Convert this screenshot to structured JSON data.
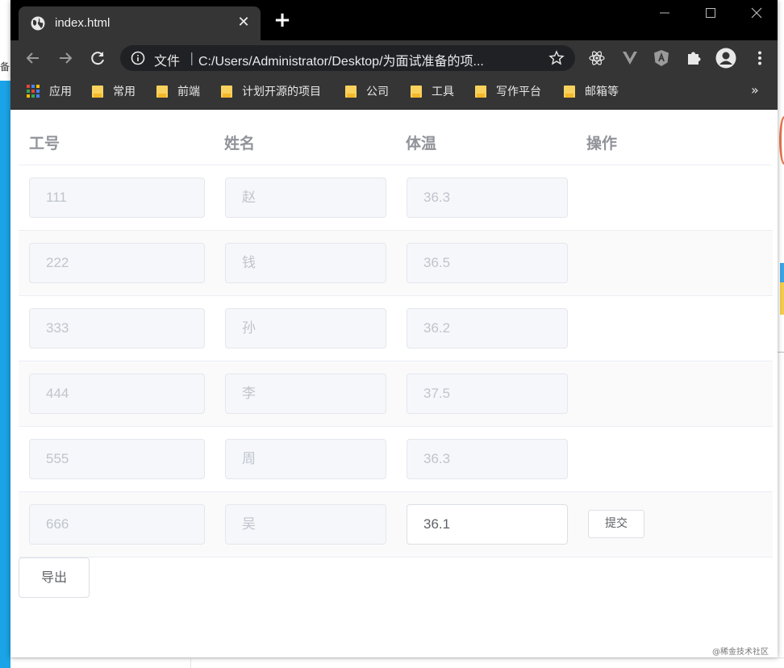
{
  "desktop": {
    "left_glyph": "备"
  },
  "browser": {
    "tab_title": "index.html",
    "omnibox": {
      "label": "文件",
      "separator": "|",
      "url": "C:/Users/Administrator/Desktop/为面试准备的项..."
    },
    "bookmarks": [
      {
        "label": "应用",
        "icon": "apps-grid-icon"
      },
      {
        "label": "常用",
        "icon": "folder-icon"
      },
      {
        "label": "前端",
        "icon": "folder-icon"
      },
      {
        "label": "计划开源的项目",
        "icon": "folder-icon"
      },
      {
        "label": "公司",
        "icon": "folder-icon"
      },
      {
        "label": "工具",
        "icon": "folder-icon"
      },
      {
        "label": "写作平台",
        "icon": "folder-icon"
      },
      {
        "label": "邮箱等",
        "icon": "folder-icon"
      }
    ],
    "bookmarks_overflow": "»",
    "colors": {
      "chrome_dark": "#353535",
      "titlebar": "#000000",
      "omnibox": "#202124"
    }
  },
  "table": {
    "headers": {
      "id": "工号",
      "name": "姓名",
      "temperature": "体温",
      "action": "操作"
    },
    "rows": [
      {
        "id": "111",
        "name": "赵",
        "temperature": "36.3"
      },
      {
        "id": "222",
        "name": "钱",
        "temperature": "36.5"
      },
      {
        "id": "333",
        "name": "孙",
        "temperature": "36.2"
      },
      {
        "id": "444",
        "name": "李",
        "temperature": "37.5"
      },
      {
        "id": "555",
        "name": "周",
        "temperature": "36.3"
      },
      {
        "id": "666",
        "name": "吴",
        "temperature": "36.1"
      }
    ],
    "submit_label": "提交",
    "colors": {
      "header_text": "#909399",
      "disabled_bg": "#f5f7fa",
      "disabled_text": "#c0c4cc",
      "stripe": "#fafafa"
    }
  },
  "export_label": "导出",
  "watermark": "@稀金技术社区"
}
